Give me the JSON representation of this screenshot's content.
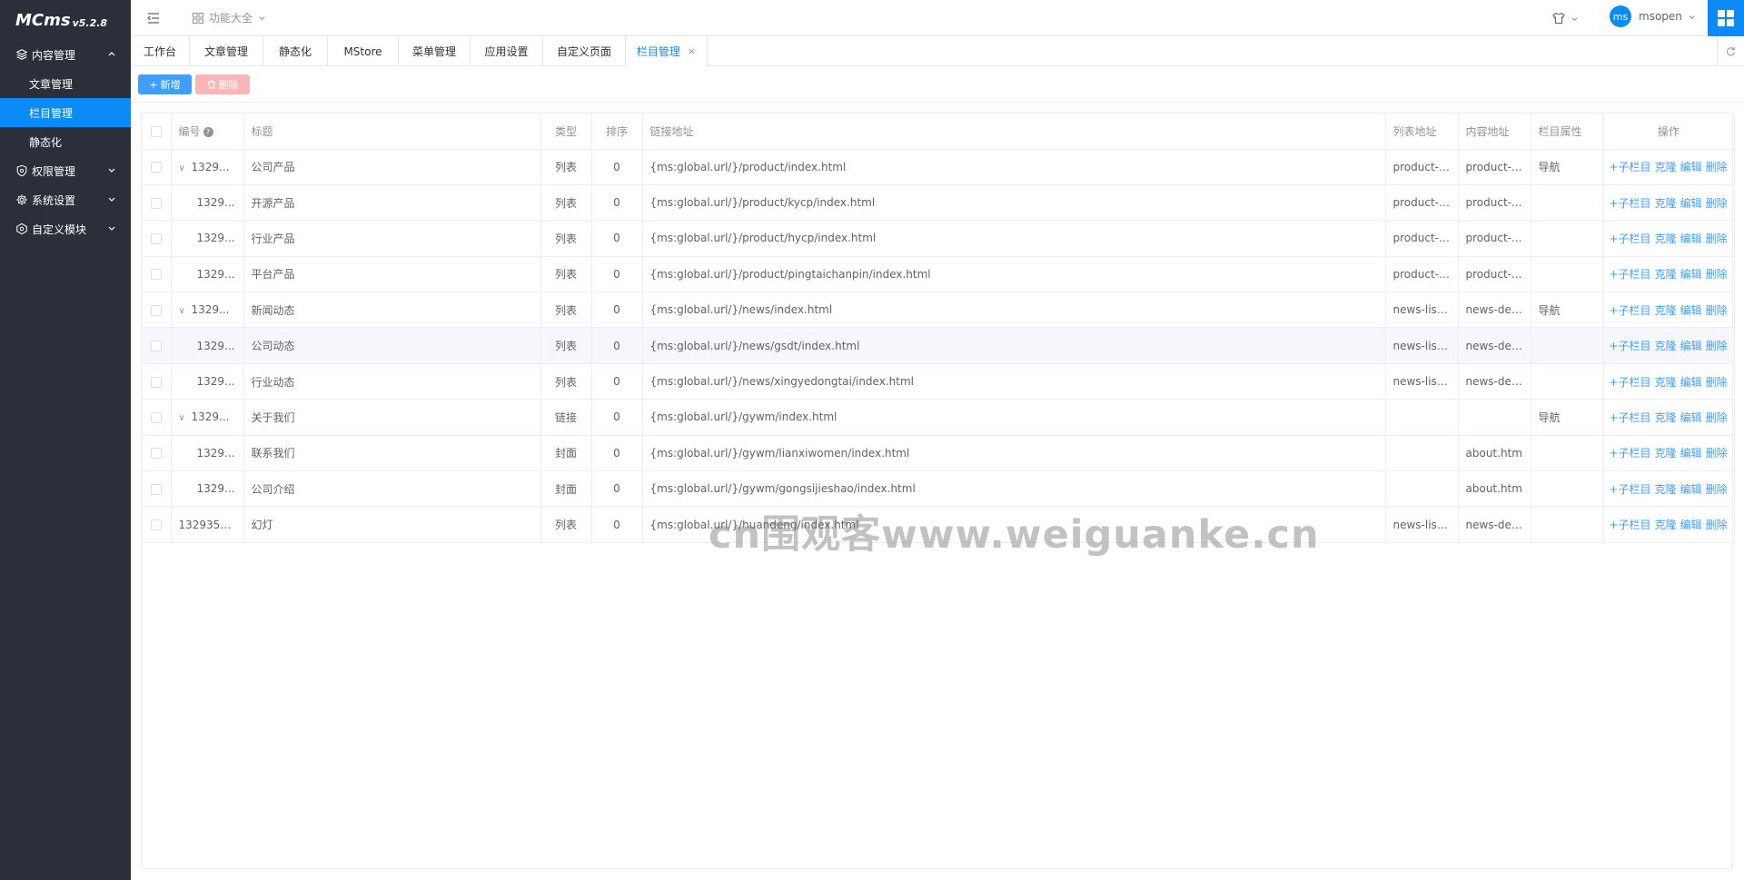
{
  "app": {
    "brand": "MCms",
    "version": "v5.2.8"
  },
  "sidebar": {
    "groups": [
      {
        "label": "内容管理",
        "icon": "layers-icon",
        "expanded": true,
        "items": [
          {
            "label": "文章管理"
          },
          {
            "label": "栏目管理",
            "active": true
          },
          {
            "label": "静态化"
          }
        ]
      },
      {
        "label": "权限管理",
        "icon": "shield-icon",
        "expanded": false
      },
      {
        "label": "系统设置",
        "icon": "gear-icon",
        "expanded": false
      },
      {
        "label": "自定义模块",
        "icon": "module-icon",
        "expanded": false
      }
    ]
  },
  "topbar": {
    "func_all": "功能大全",
    "user": {
      "avatar": "ms",
      "name": "msopen"
    }
  },
  "tabs": [
    {
      "label": "工作台"
    },
    {
      "label": "文章管理"
    },
    {
      "label": "静态化"
    },
    {
      "label": "MStore"
    },
    {
      "label": "菜单管理"
    },
    {
      "label": "应用设置"
    },
    {
      "label": "自定义页面"
    },
    {
      "label": "栏目管理",
      "active": true,
      "close": "×"
    }
  ],
  "toolbar": {
    "add_label": "新增",
    "delete_label": "删除"
  },
  "table": {
    "headers": {
      "id": "编号",
      "title": "标题",
      "type": "类型",
      "sort": "排序",
      "url": "链接地址",
      "list_url": "列表地址",
      "content_url": "内容地址",
      "attr": "栏目属性",
      "ops": "操作"
    },
    "ops": {
      "child": "+子栏目",
      "clone": "克隆",
      "edit": "编辑",
      "delete": "删除"
    },
    "rows": [
      {
        "id": "1329...",
        "title": "公司产品",
        "type": "列表",
        "sort": "0",
        "url": "{ms:global.url/}/product/index.html",
        "list_url": "product-l...",
        "content_url": "product-...",
        "attr": "导航",
        "level": 0,
        "expandable": true
      },
      {
        "id": "1329...",
        "title": "开源产品",
        "type": "列表",
        "sort": "0",
        "url": "{ms:global.url/}/product/kycp/index.html",
        "list_url": "product-l...",
        "content_url": "product-...",
        "attr": "",
        "level": 1
      },
      {
        "id": "1329...",
        "title": "行业产品",
        "type": "列表",
        "sort": "0",
        "url": "{ms:global.url/}/product/hycp/index.html",
        "list_url": "product-l...",
        "content_url": "product-...",
        "attr": "",
        "level": 1
      },
      {
        "id": "1329...",
        "title": "平台产品",
        "type": "列表",
        "sort": "0",
        "url": "{ms:global.url/}/product/pingtaichanpin/index.html",
        "list_url": "product-l...",
        "content_url": "product-...",
        "attr": "",
        "level": 1
      },
      {
        "id": "1329...",
        "title": "新闻动态",
        "type": "列表",
        "sort": "0",
        "url": "{ms:global.url/}/news/index.html",
        "list_url": "news-list...",
        "content_url": "news-det...",
        "attr": "导航",
        "level": 0,
        "expandable": true
      },
      {
        "id": "1329...",
        "title": "公司动态",
        "type": "列表",
        "sort": "0",
        "url": "{ms:global.url/}/news/gsdt/index.html",
        "list_url": "news-list...",
        "content_url": "news-det...",
        "attr": "",
        "level": 1,
        "highlight": true
      },
      {
        "id": "1329...",
        "title": "行业动态",
        "type": "列表",
        "sort": "0",
        "url": "{ms:global.url/}/news/xingyedongtai/index.html",
        "list_url": "news-list...",
        "content_url": "news-det...",
        "attr": "",
        "level": 1
      },
      {
        "id": "1329...",
        "title": "关于我们",
        "type": "链接",
        "sort": "0",
        "url": "{ms:global.url/}/gywm/index.html",
        "list_url": "",
        "content_url": "",
        "attr": "导航",
        "level": 0,
        "expandable": true
      },
      {
        "id": "1329...",
        "title": "联系我们",
        "type": "封面",
        "sort": "0",
        "url": "{ms:global.url/}/gywm/lianxiwomen/index.html",
        "list_url": "",
        "content_url": "about.htm",
        "attr": "",
        "level": 1
      },
      {
        "id": "1329...",
        "title": "公司介绍",
        "type": "封面",
        "sort": "0",
        "url": "{ms:global.url/}/gywm/gongsijieshao/index.html",
        "list_url": "",
        "content_url": "about.htm",
        "attr": "",
        "level": 1
      },
      {
        "id": "1329357...",
        "title": "幻灯",
        "type": "列表",
        "sort": "0",
        "url": "{ms:global.url/}/huandeng/index.html",
        "list_url": "news-list...",
        "content_url": "news-det...",
        "attr": "",
        "level": 0
      }
    ]
  },
  "watermark": "cn围观客www.weiguanke.cn",
  "colors": {
    "sidebar_bg": "#2b2f3a",
    "accent": "#0b8bf5",
    "primary_button": "#409eff",
    "danger_disabled": "#fab6b6"
  }
}
